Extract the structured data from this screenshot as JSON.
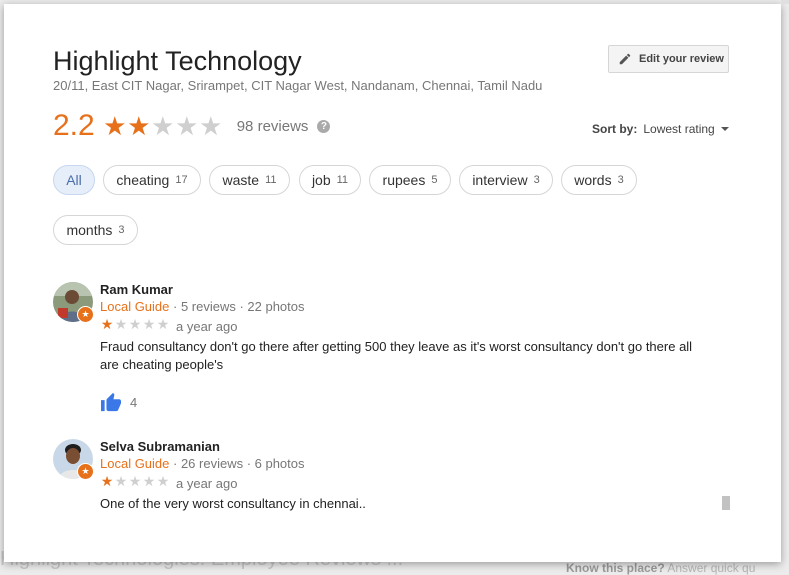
{
  "background": {
    "left_text": "Highlight Technologies: Employee Reviews ...",
    "right_prompt": "Know this place?",
    "right_link": "Answer quick qu"
  },
  "place": {
    "name": "Highlight Technology",
    "address": "20/11, East CIT Nagar, Srirampet, CIT Nagar West, Nandanam, Chennai, Tamil Nadu"
  },
  "edit_review": {
    "label": "Edit your review",
    "icon": "pencil-icon"
  },
  "rating": {
    "score": "2.2",
    "stars_filled": 2,
    "stars_total": 5,
    "reviews_label": "98 reviews",
    "help_icon": "?"
  },
  "sort": {
    "label": "Sort by:",
    "value": "Lowest rating"
  },
  "filters": [
    {
      "label": "All",
      "count": "",
      "active": true
    },
    {
      "label": "cheating",
      "count": "17"
    },
    {
      "label": "waste",
      "count": "11"
    },
    {
      "label": "job",
      "count": "11"
    },
    {
      "label": "rupees",
      "count": "5"
    },
    {
      "label": "interview",
      "count": "3"
    },
    {
      "label": "words",
      "count": "3"
    },
    {
      "label": "months",
      "count": "3"
    }
  ],
  "reviews": [
    {
      "name": "Ram Kumar",
      "badge": "Local Guide",
      "stats": " · 5 reviews · 22 photos",
      "stars": 1,
      "date": "a year ago",
      "text": "Fraud consultancy  don't go there after getting 500 they leave as it's worst consultancy don't go there all are cheating people's",
      "likes": "4"
    },
    {
      "name": "Selva Subramanian",
      "badge": "Local Guide",
      "stats": " · 26 reviews · 6 photos",
      "stars": 1,
      "date": "a year ago",
      "text": "One of the very worst consultancy in chennai..",
      "likes": ""
    }
  ],
  "colors": {
    "accent": "#e7711b",
    "like_blue": "#3b78e7",
    "chip_active_bg": "#e6eef9"
  }
}
